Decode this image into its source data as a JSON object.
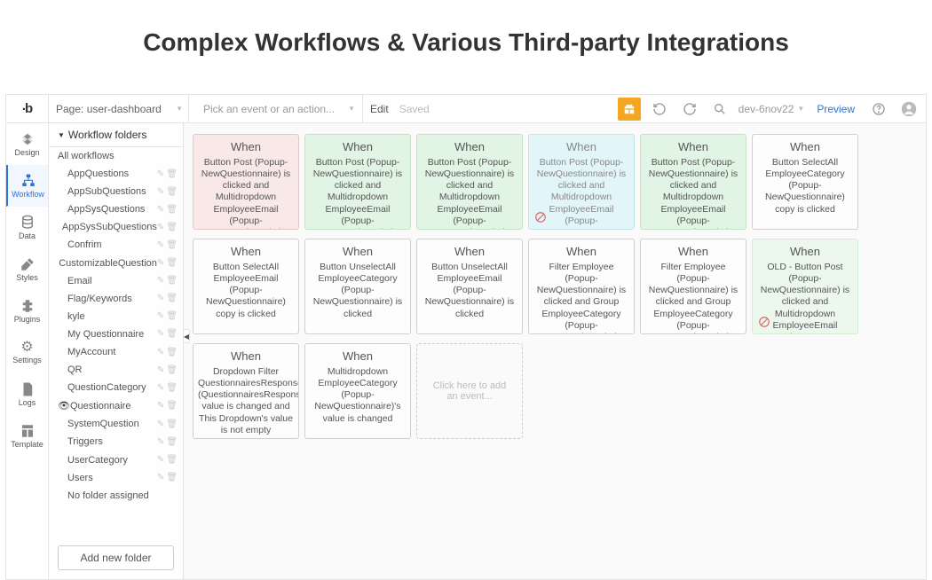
{
  "page_title": "Complex Workflows & Various Third-party Integrations",
  "topbar": {
    "logo": "b",
    "page_label_prefix": "Page: ",
    "page_label": "Page: user-dashboard",
    "action_placeholder": "Pick an event or an action...",
    "edit_label": "Edit",
    "saved_label": "Saved",
    "branch": "dev-6nov22",
    "preview": "Preview"
  },
  "nav": {
    "items": [
      {
        "id": "design",
        "label": "Design"
      },
      {
        "id": "workflow",
        "label": "Workflow"
      },
      {
        "id": "data",
        "label": "Data"
      },
      {
        "id": "styles",
        "label": "Styles"
      },
      {
        "id": "plugins",
        "label": "Plugins"
      },
      {
        "id": "settings",
        "label": "Settings"
      },
      {
        "id": "logs",
        "label": "Logs"
      },
      {
        "id": "template",
        "label": "Template"
      }
    ]
  },
  "sidebar": {
    "header": "Workflow folders",
    "all": "All workflows",
    "folders": [
      "AppQuestions",
      "AppSubQuestions",
      "AppSysQuestions",
      "AppSysSubQuestions",
      "Confrim",
      "CustomizableQuestion",
      "Email",
      "Flag/Keywords",
      "kyle",
      "My Questionnaire",
      "MyAccount",
      "QR",
      "QuestionCategory",
      "Questionnaire",
      "SystemQuestion",
      "Triggers",
      "UserCategory",
      "Users",
      "No folder assigned"
    ],
    "active_index": 13,
    "add_folder": "Add new folder"
  },
  "canvas": {
    "when_label": "When",
    "add_card": "Click here to add an event...",
    "cards": [
      {
        "color": "red",
        "desc": "Button Post (Popup-NewQuestionnaire) is clicked and Multidropdown EmployeeEmail (Popup-NewQuestionnaire)'s"
      },
      {
        "color": "green",
        "desc": "Button Post (Popup-NewQuestionnaire) is clicked and Multidropdown EmployeeEmail (Popup-NewQuestionnaire)'s"
      },
      {
        "color": "green",
        "desc": "Button Post (Popup-NewQuestionnaire) is clicked and Multidropdown EmployeeEmail (Popup-NewQuestionnaire)'s"
      },
      {
        "color": "cyan",
        "badge": "no",
        "desc": "Button Post (Popup-NewQuestionnaire) is clicked and Multidropdown EmployeeEmail (Popup-"
      },
      {
        "color": "green",
        "desc": "Button Post (Popup-NewQuestionnaire) is clicked and Multidropdown EmployeeEmail (Popup-NewQuestionnaire)'s"
      },
      {
        "color": "",
        "desc": "Button SelectAll EmployeeCategory (Popup-NewQuestionnaire) copy is clicked"
      },
      {
        "color": "",
        "desc": "Button SelectAll EmployeeEmail (Popup-NewQuestionnaire) copy is clicked"
      },
      {
        "color": "",
        "desc": "Button UnselectAll EmployeeCategory (Popup-NewQuestionnaire) is clicked"
      },
      {
        "color": "",
        "desc": "Button UnselectAll EmployeeEmail (Popup-NewQuestionnaire) is clicked"
      },
      {
        "color": "",
        "desc": "Filter Employee (Popup-NewQuestionnaire) is clicked and Group EmployeeCategory (Popup-NewQuestionnaire)'s"
      },
      {
        "color": "",
        "desc": "Filter Employee (Popup-NewQuestionnaire) is clicked and Group EmployeeCategory (Popup-NewQuestionnaire)'s"
      },
      {
        "color": "greenL",
        "badge": "no",
        "desc": "OLD - Button Post (Popup-NewQuestionnaire) is clicked and Multidropdown EmployeeEmail (Popup-"
      },
      {
        "color": "",
        "desc": "Dropdown Filter QuestionnairesResponse (QuestionnairesResponse value is changed and This Dropdown's value is not empty"
      },
      {
        "color": "",
        "desc": "Multidropdown EmployeeCategory (Popup-NewQuestionnaire)'s value is changed"
      }
    ]
  }
}
